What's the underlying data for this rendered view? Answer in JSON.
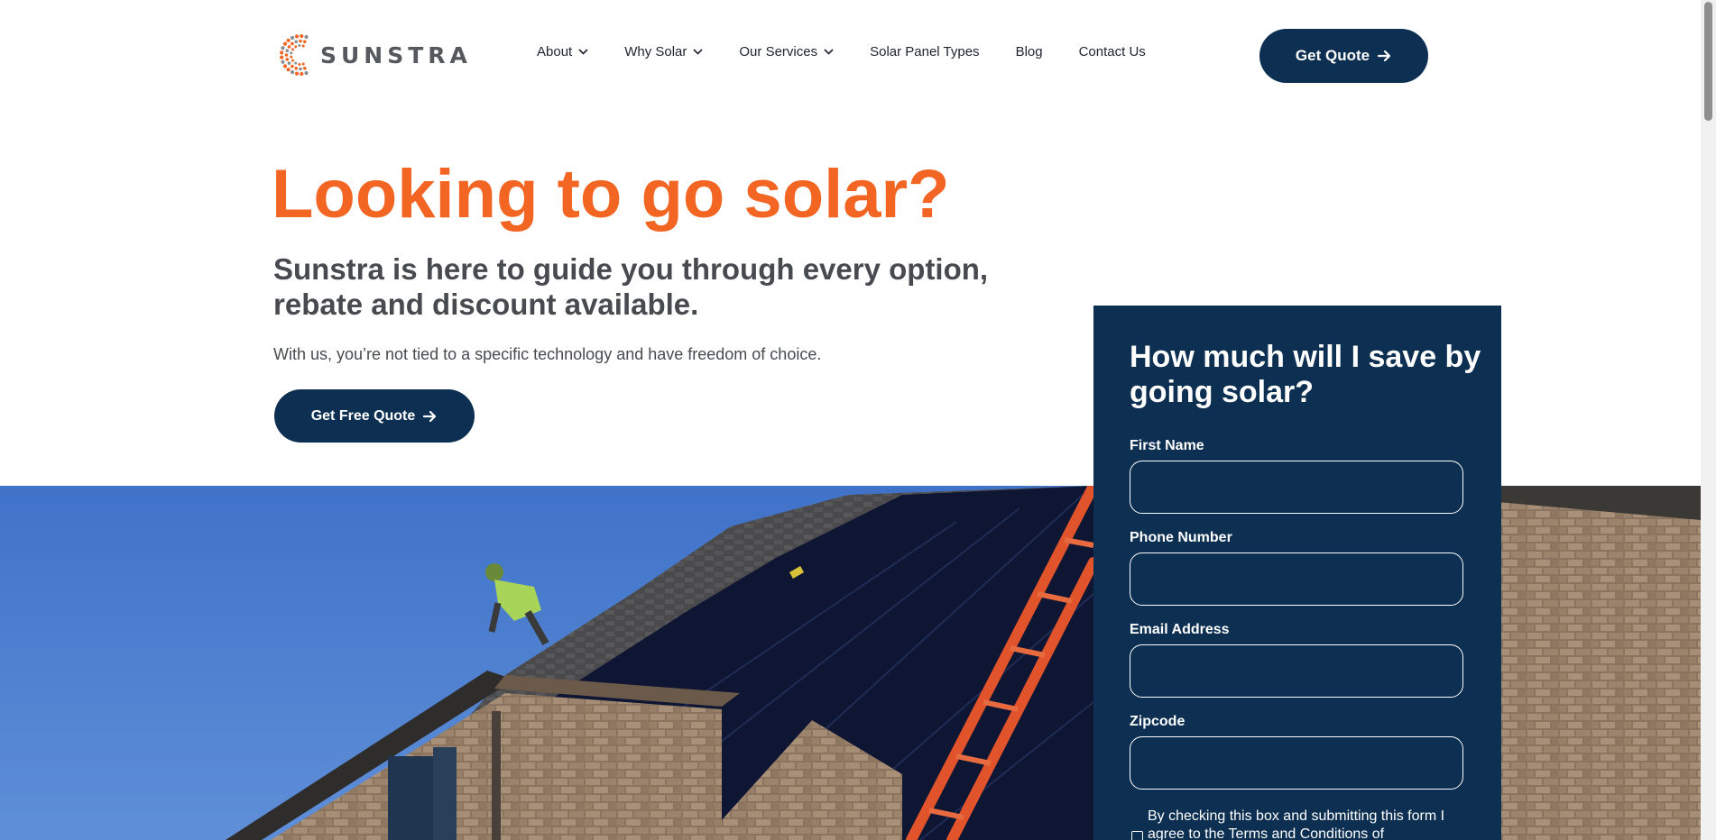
{
  "brand": {
    "name": "SUNSTRA",
    "accent": "#f26522",
    "navy": "#0d2f52"
  },
  "nav": {
    "items": [
      {
        "label": "About",
        "has_dropdown": true
      },
      {
        "label": "Why Solar",
        "has_dropdown": true
      },
      {
        "label": "Our Services",
        "has_dropdown": true
      },
      {
        "label": "Solar Panel Types",
        "has_dropdown": false
      },
      {
        "label": "Blog",
        "has_dropdown": false
      },
      {
        "label": "Contact Us",
        "has_dropdown": false
      }
    ],
    "cta_label": "Get Quote"
  },
  "hero": {
    "title": "Looking to go solar?",
    "subtitle": "Sunstra is here to guide you through every option, rebate and discount available.",
    "body": "With us, you’re not tied to a specific technology and have freedom of choice.",
    "cta_label": "Get Free Quote"
  },
  "form": {
    "title": "How much will I save by going solar?",
    "fields": [
      {
        "label": "First Name",
        "value": ""
      },
      {
        "label": "Phone Number",
        "value": ""
      },
      {
        "label": "Email Address",
        "value": ""
      },
      {
        "label": "Zipcode",
        "value": ""
      }
    ],
    "consent_text": "By checking this box and submitting this form I agree to the Terms and Conditions of",
    "consent_checked": false
  },
  "icons": {
    "dropdown": "chevron-down-icon",
    "arrow": "arrow-right-icon",
    "logo": "sunburst-logo-icon"
  }
}
